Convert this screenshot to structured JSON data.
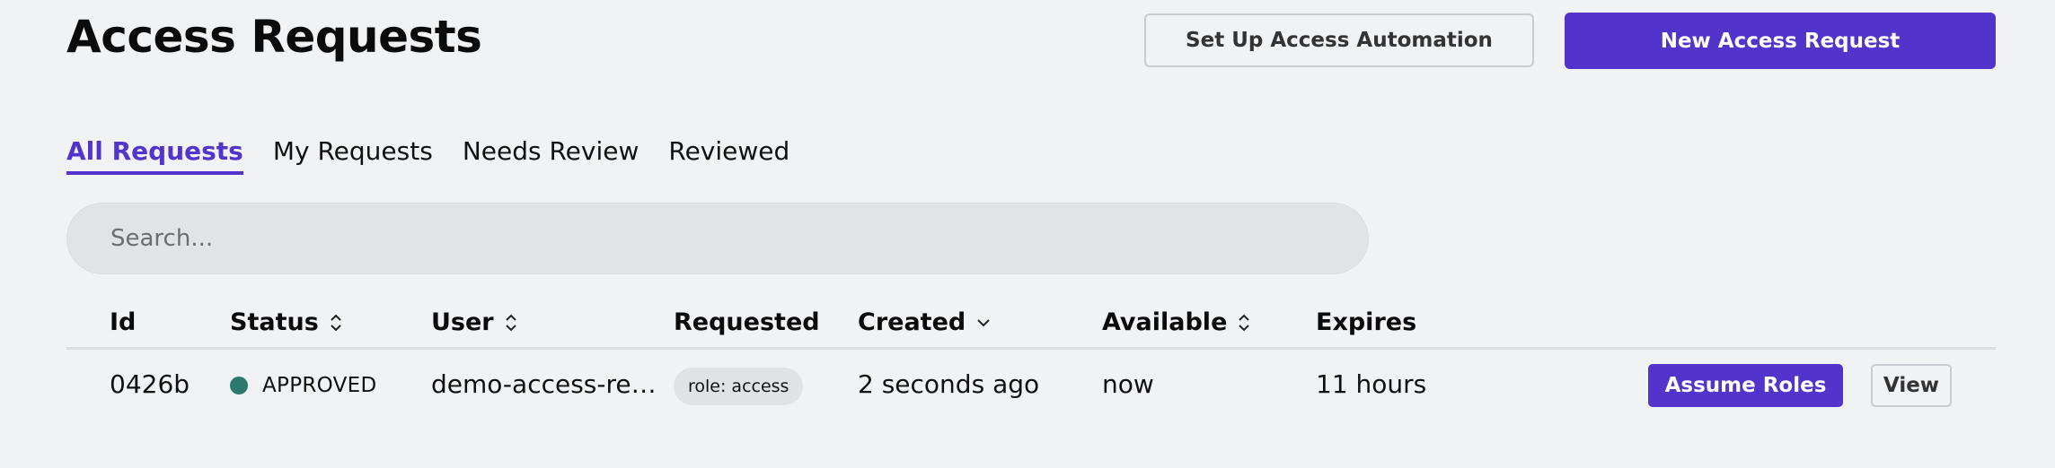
{
  "header": {
    "title": "Access Requests",
    "automation_button": "Set Up Access Automation",
    "new_request_button": "New Access Request"
  },
  "tabs": [
    {
      "label": "All Requests",
      "active": true
    },
    {
      "label": "My Requests",
      "active": false
    },
    {
      "label": "Needs Review",
      "active": false
    },
    {
      "label": "Reviewed",
      "active": false
    }
  ],
  "search": {
    "placeholder": "Search...",
    "value": ""
  },
  "table": {
    "columns": [
      {
        "label": "Id",
        "sort_icon": ""
      },
      {
        "label": "Status",
        "sort_icon": "sort-both-icon"
      },
      {
        "label": "User",
        "sort_icon": "sort-both-icon"
      },
      {
        "label": "Requested",
        "sort_icon": ""
      },
      {
        "label": "Created",
        "sort_icon": "chevron-down-icon"
      },
      {
        "label": "Available",
        "sort_icon": "sort-both-icon"
      },
      {
        "label": "Expires",
        "sort_icon": ""
      }
    ],
    "rows": [
      {
        "id": "0426b",
        "status": "APPROVED",
        "user": "demo-access-re…",
        "requested": "role: access",
        "created": "2 seconds ago",
        "available": "now",
        "expires": "11 hours",
        "assume_button": "Assume Roles",
        "view_button": "View"
      }
    ]
  },
  "colors": {
    "accent": "#5233cc",
    "background": "#f1f2f4",
    "status_approved": "#2c7a6e"
  }
}
